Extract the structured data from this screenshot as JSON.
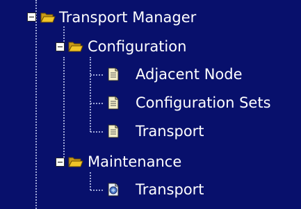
{
  "colors": {
    "background": "#08106c",
    "text": "#ffffff",
    "dotted_line": "#a0a8d8",
    "folder": "#f0c428",
    "document": "#f4efc8"
  },
  "tree": {
    "root": {
      "label": "Transport Manager",
      "state": "expanded",
      "icon": "folder-open-icon",
      "children": {
        "configuration": {
          "label": "Configuration",
          "state": "expanded",
          "icon": "folder-open-icon",
          "items": [
            {
              "label": "Adjacent Node",
              "icon": "document-icon"
            },
            {
              "label": "Configuration Sets",
              "icon": "document-icon"
            },
            {
              "label": "Transport",
              "icon": "document-icon"
            }
          ]
        },
        "maintenance": {
          "label": "Maintenance",
          "state": "expanded",
          "icon": "folder-open-icon",
          "items": [
            {
              "label": "Transport",
              "icon": "maintenance-document-icon"
            }
          ]
        }
      }
    }
  }
}
